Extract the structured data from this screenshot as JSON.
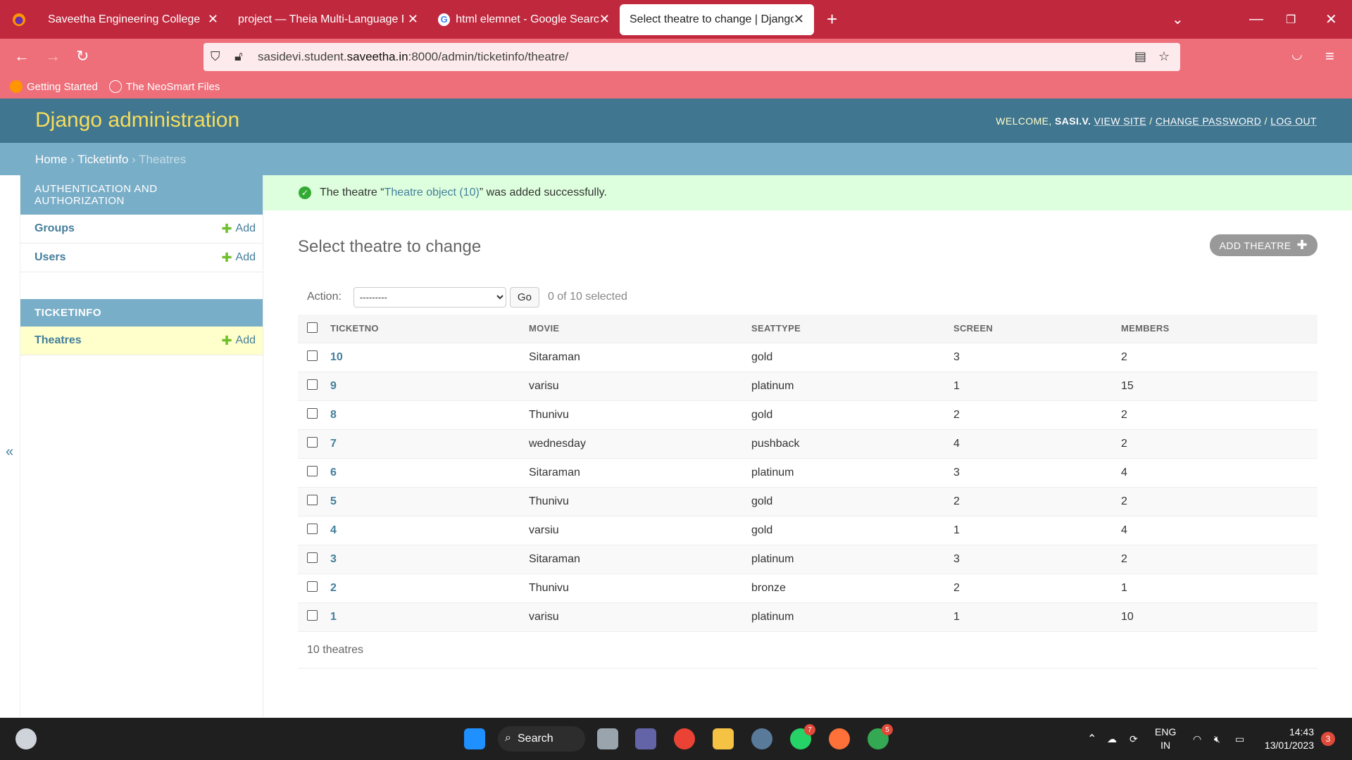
{
  "browser": {
    "tabs": [
      {
        "label": "Saveetha Engineering College",
        "active": false
      },
      {
        "label": "project — Theia Multi-Language Ex",
        "active": false
      },
      {
        "label": "html elemnet - Google Search",
        "active": false
      },
      {
        "label": "Select theatre to change | Django si",
        "active": true
      }
    ],
    "url_prefix": "sasidevi.student.",
    "url_domain": "saveetha.in",
    "url_suffix": ":8000/admin/ticketinfo/theatre/",
    "bookmarks": [
      "Getting Started",
      "The NeoSmart Files"
    ]
  },
  "header": {
    "brand": "Django administration",
    "welcome": "WELCOME,",
    "username": "SASI.V.",
    "view_site": "VIEW SITE",
    "change_password": "CHANGE PASSWORD",
    "log_out": "LOG OUT",
    "sep": "/"
  },
  "breadcrumbs": {
    "home": "Home",
    "app": "Ticketinfo",
    "current": "Theatres",
    "sep": "›"
  },
  "sidebar": {
    "modules": [
      {
        "caption": "Authentication and Authorization",
        "items": [
          {
            "name": "Groups",
            "add": "Add"
          },
          {
            "name": "Users",
            "add": "Add"
          }
        ]
      },
      {
        "caption": "Ticketinfo",
        "items": [
          {
            "name": "Theatres",
            "add": "Add"
          }
        ]
      }
    ],
    "toggle": "«"
  },
  "message": {
    "before": "The theatre “",
    "link": "Theatre object (10)",
    "after": "” was added successfully."
  },
  "page": {
    "title": "Select theatre to change",
    "add_button": "ADD THEATRE"
  },
  "actions": {
    "label": "Action:",
    "selected": "---------",
    "go": "Go",
    "counter": "0 of 10 selected"
  },
  "table": {
    "headers": [
      "TICKETNO",
      "MOVIE",
      "SEATTYPE",
      "SCREEN",
      "MEMBERS"
    ],
    "rows": [
      [
        "10",
        "Sitaraman",
        "gold",
        "3",
        "2"
      ],
      [
        "9",
        "varisu",
        "platinum",
        "1",
        "15"
      ],
      [
        "8",
        "Thunivu",
        "gold",
        "2",
        "2"
      ],
      [
        "7",
        "wednesday",
        "pushback",
        "4",
        "2"
      ],
      [
        "6",
        "Sitaraman",
        "platinum",
        "3",
        "4"
      ],
      [
        "5",
        "Thunivu",
        "gold",
        "2",
        "2"
      ],
      [
        "4",
        "varsiu",
        "gold",
        "1",
        "4"
      ],
      [
        "3",
        "Sitaraman",
        "platinum",
        "3",
        "2"
      ],
      [
        "2",
        "Thunivu",
        "bronze",
        "2",
        "1"
      ],
      [
        "1",
        "varisu",
        "platinum",
        "1",
        "10"
      ]
    ]
  },
  "paginator": "10 theatres",
  "taskbar": {
    "search": "Search",
    "lang_top": "ENG",
    "lang_bottom": "IN",
    "time": "14:43",
    "date": "13/01/2023",
    "whatsapp_badge": "7",
    "chrome_badge": "5",
    "notif_badge": "3"
  },
  "colors": {
    "tabbar": "#c0283e",
    "navbar": "#ee6f7a",
    "django_header": "#417690",
    "breadcrumbs": "#79aec8",
    "brand": "#f5dd5d",
    "link": "#447e9b",
    "success_bg": "#ddffdd"
  }
}
